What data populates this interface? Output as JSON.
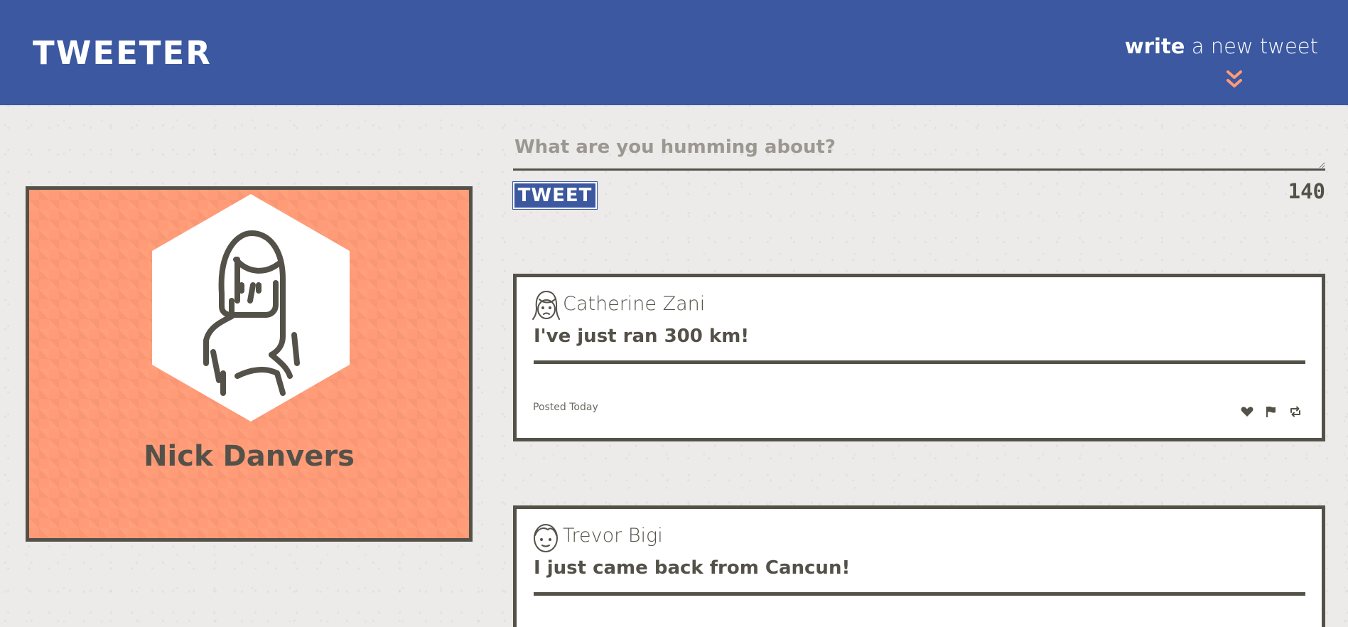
{
  "header": {
    "brand": "TWEETER",
    "compose_bold": "write",
    "compose_rest": " a new tweet"
  },
  "profile": {
    "name": "Nick Danvers",
    "avatar_icon": "girl-avatar-icon"
  },
  "composer": {
    "placeholder": "What are you humming about?",
    "button_label": "TWEET",
    "counter": "140"
  },
  "tweets": [
    {
      "author": "Catherine Zani",
      "content": "I've just ran 300 km!",
      "posted": "Posted Today"
    },
    {
      "author": "Trevor Bigi",
      "content": "I just came back from Cancun!"
    }
  ],
  "colors": {
    "navbar": "#3b58a0",
    "accent": "#ff9b77",
    "text": "#545149"
  }
}
